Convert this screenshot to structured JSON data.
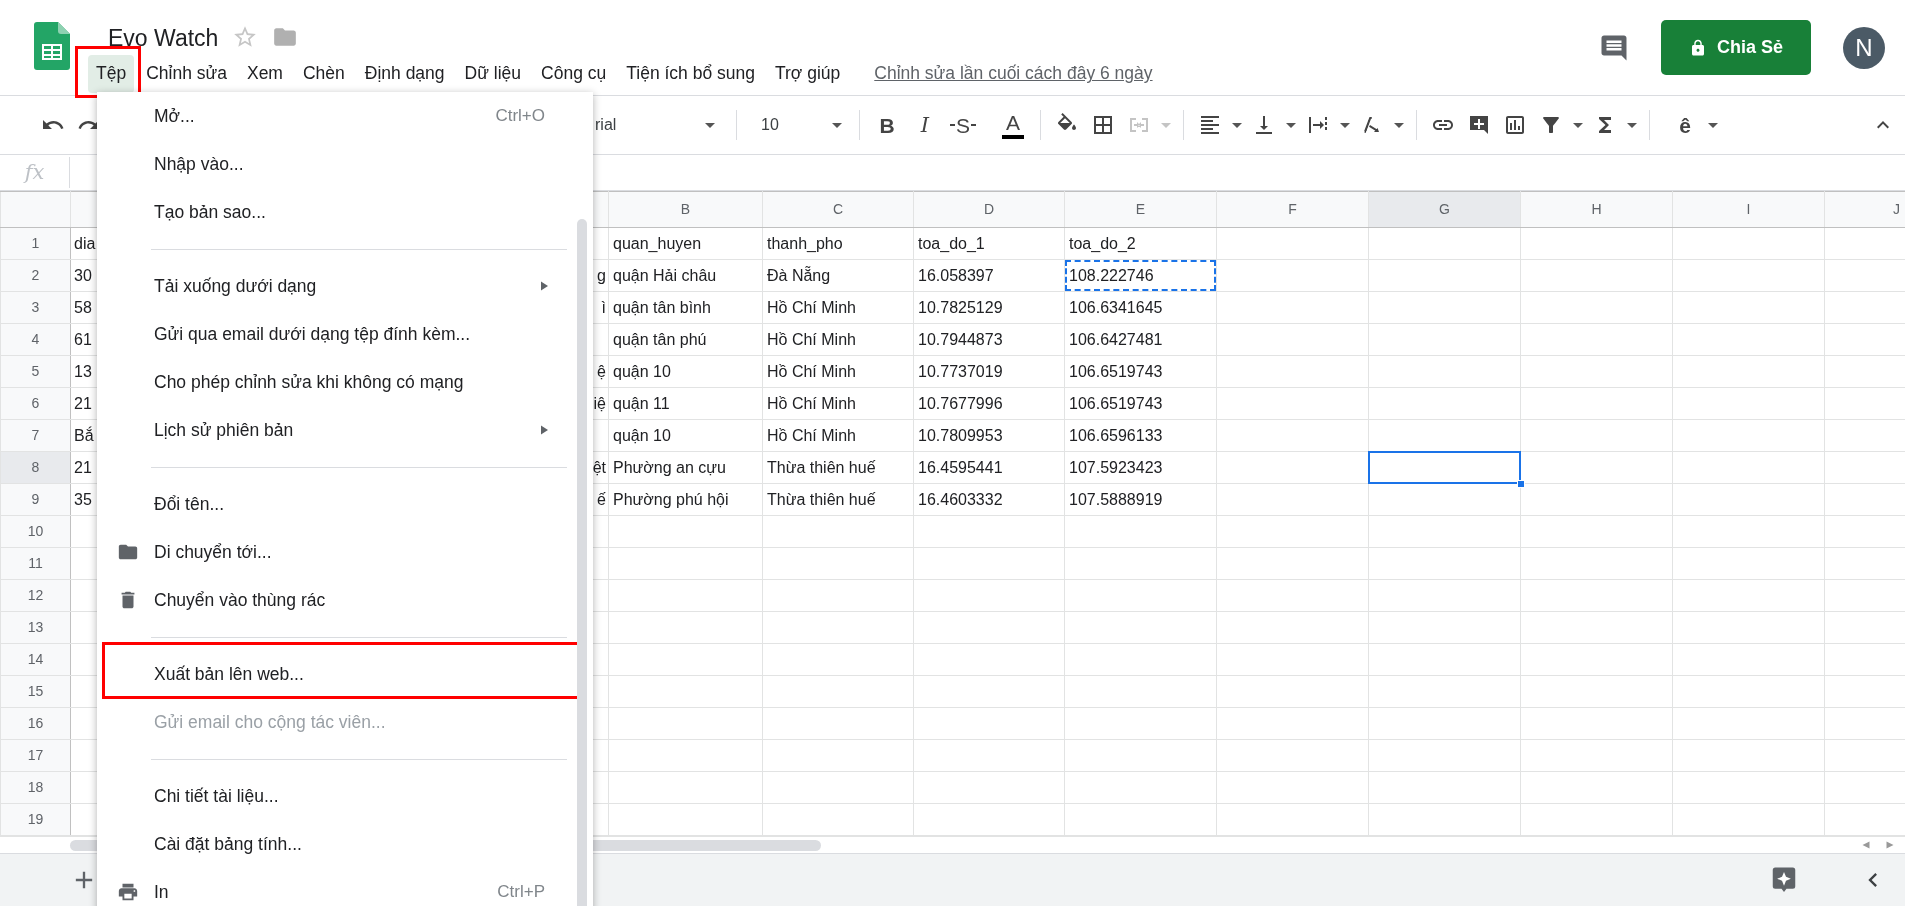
{
  "document": {
    "title": "Evo Watch",
    "starred": false,
    "last_edit": "Chỉnh sửa lần cuối cách đây 6 ngày"
  },
  "menubar": [
    {
      "label": "Tệp",
      "selected": true,
      "annotated": true
    },
    {
      "label": "Chỉnh sửa",
      "selected": false,
      "annotated": false
    },
    {
      "label": "Xem",
      "selected": false,
      "annotated": false
    },
    {
      "label": "Chèn",
      "selected": false,
      "annotated": false
    },
    {
      "label": "Định dạng",
      "selected": false,
      "annotated": false
    },
    {
      "label": "Dữ liệu",
      "selected": false,
      "annotated": false
    },
    {
      "label": "Công cụ",
      "selected": false,
      "annotated": false
    },
    {
      "label": "Tiện ích bổ sung",
      "selected": false,
      "annotated": false
    },
    {
      "label": "Trợ giúp",
      "selected": false,
      "annotated": false
    }
  ],
  "share_button": {
    "label": "Chia Sẻ"
  },
  "avatar": {
    "initial": "N"
  },
  "toolbar": {
    "font": "rial",
    "font_size": "10",
    "merge_disabled": true,
    "input_tool": "ê",
    "format_buttons": [
      {
        "kind": "bold",
        "glyph": "B"
      },
      {
        "kind": "italic",
        "glyph": "I"
      },
      {
        "kind": "strikethrough",
        "glyph": "S"
      },
      {
        "kind": "text_color",
        "glyph": "A"
      }
    ]
  },
  "formula_bar": {
    "label": "fx"
  },
  "columns": [
    {
      "label": "B",
      "selected": false
    },
    {
      "label": "C",
      "selected": false
    },
    {
      "label": "D",
      "selected": false
    },
    {
      "label": "E",
      "selected": false
    },
    {
      "label": "F",
      "selected": false
    },
    {
      "label": "G",
      "selected": true
    },
    {
      "label": "H",
      "selected": false
    },
    {
      "label": "I",
      "selected": false
    },
    {
      "label": "J",
      "selected": false
    }
  ],
  "rows": [
    {
      "number": "1",
      "selected": false,
      "column_a": {
        "start": "dia"
      },
      "cells": [
        {
          "text": "quan_huyen",
          "copied": false
        },
        {
          "text": "thanh_pho",
          "copied": false
        },
        {
          "text": "toa_do_1",
          "copied": false
        },
        {
          "text": "toa_do_2",
          "copied": false
        }
      ]
    },
    {
      "number": "2",
      "selected": false,
      "column_a": {
        "start": "30",
        "end": "g"
      },
      "cells": [
        {
          "text": "quận Hải châu",
          "copied": false
        },
        {
          "text": "Đà Nẵng",
          "copied": false
        },
        {
          "text": "16.058397",
          "copied": false
        },
        {
          "text": "108.222746",
          "copied": true
        }
      ]
    },
    {
      "number": "3",
      "selected": false,
      "column_a": {
        "start": "58",
        "end": "ì"
      },
      "cells": [
        {
          "text": "quận tân bình",
          "copied": false
        },
        {
          "text": "Hồ Chí Minh",
          "copied": false
        },
        {
          "text": "10.7825129",
          "copied": false
        },
        {
          "text": "106.6341645",
          "copied": false
        }
      ]
    },
    {
      "number": "4",
      "selected": false,
      "column_a": {
        "start": "61"
      },
      "cells": [
        {
          "text": "quận tân phú",
          "copied": false
        },
        {
          "text": "Hồ Chí Minh",
          "copied": false
        },
        {
          "text": "10.7944873",
          "copied": false
        },
        {
          "text": "106.6427481",
          "copied": false
        }
      ]
    },
    {
      "number": "5",
      "selected": false,
      "column_a": {
        "start": "13",
        "end": "ệ"
      },
      "cells": [
        {
          "text": "quận 10",
          "copied": false
        },
        {
          "text": "Hồ Chí Minh",
          "copied": false
        },
        {
          "text": "10.7737019",
          "copied": false
        },
        {
          "text": "106.6519743",
          "copied": false
        }
      ]
    },
    {
      "number": "6",
      "selected": false,
      "column_a": {
        "start": "21",
        "end": "iệ"
      },
      "cells": [
        {
          "text": "quận 11",
          "copied": false
        },
        {
          "text": "Hồ Chí Minh",
          "copied": false
        },
        {
          "text": "10.7677996",
          "copied": false
        },
        {
          "text": "106.6519743",
          "copied": false
        }
      ]
    },
    {
      "number": "7",
      "selected": false,
      "column_a": {
        "start": "Bắ"
      },
      "cells": [
        {
          "text": "quận 10",
          "copied": false
        },
        {
          "text": "Hồ Chí Minh",
          "copied": false
        },
        {
          "text": "10.7809953",
          "copied": false
        },
        {
          "text": "106.6596133",
          "copied": false
        }
      ]
    },
    {
      "number": "8",
      "selected": true,
      "column_a": {
        "start": "21",
        "end": "ệt"
      },
      "cells": [
        {
          "text": "Phường an cựu",
          "copied": false
        },
        {
          "text": "Thừa thiên huế",
          "copied": false
        },
        {
          "text": "16.4595441",
          "copied": false
        },
        {
          "text": "107.5923423",
          "copied": false
        }
      ]
    },
    {
      "number": "9",
      "selected": false,
      "column_a": {
        "start": "35",
        "end": "ế"
      },
      "cells": [
        {
          "text": "Phường phú hội",
          "copied": false
        },
        {
          "text": "Thừa thiên huế",
          "copied": false
        },
        {
          "text": "16.4603332",
          "copied": false
        },
        {
          "text": "107.5888919",
          "copied": false
        }
      ]
    },
    {
      "number": "10",
      "selected": false
    },
    {
      "number": "11",
      "selected": false
    },
    {
      "number": "12",
      "selected": false
    },
    {
      "number": "13",
      "selected": false
    },
    {
      "number": "14",
      "selected": false
    },
    {
      "number": "15",
      "selected": false
    },
    {
      "number": "16",
      "selected": false
    },
    {
      "number": "17",
      "selected": false
    },
    {
      "number": "18",
      "selected": false
    },
    {
      "number": "19",
      "selected": false
    }
  ],
  "file_menu": {
    "items": [
      {
        "kind": "item",
        "label": "Mở...",
        "shortcut": "Ctrl+O",
        "disabled": false,
        "submenu": false,
        "annotated": false
      },
      {
        "kind": "item",
        "label": "Nhập vào...",
        "disabled": false,
        "submenu": false,
        "annotated": false
      },
      {
        "kind": "item",
        "label": "Tạo bản sao...",
        "disabled": false,
        "submenu": false,
        "annotated": false
      },
      {
        "kind": "separator"
      },
      {
        "kind": "item",
        "label": "Tải xuống dưới dạng",
        "disabled": false,
        "submenu": true,
        "annotated": false
      },
      {
        "kind": "item",
        "label": "Gửi qua email dưới dạng tệp đính kèm...",
        "disabled": false,
        "submenu": false,
        "annotated": false
      },
      {
        "kind": "item",
        "label": "Cho phép chỉnh sửa khi không có mạng",
        "disabled": false,
        "submenu": false,
        "annotated": false
      },
      {
        "kind": "item",
        "label": "Lịch sử phiên bản",
        "disabled": false,
        "submenu": true,
        "annotated": false
      },
      {
        "kind": "separator"
      },
      {
        "kind": "item",
        "label": "Đổi tên...",
        "disabled": false,
        "submenu": false,
        "annotated": false
      },
      {
        "kind": "folder",
        "label": "Di chuyển tới...",
        "disabled": false,
        "submenu": false,
        "annotated": false
      },
      {
        "kind": "trash",
        "label": "Chuyển vào thùng rác",
        "disabled": false,
        "submenu": false,
        "annotated": false
      },
      {
        "kind": "separator"
      },
      {
        "kind": "item",
        "label": "Xuất bản lên web...",
        "disabled": false,
        "submenu": false,
        "annotated": true
      },
      {
        "kind": "item",
        "label": "Gửi email cho cộng tác viên...",
        "disabled": true,
        "submenu": false,
        "annotated": false
      },
      {
        "kind": "separator"
      },
      {
        "kind": "item",
        "label": "Chi tiết tài liệu...",
        "disabled": false,
        "submenu": false,
        "annotated": false
      },
      {
        "kind": "item",
        "label": "Cài đặt bảng tính...",
        "disabled": false,
        "submenu": false,
        "annotated": false
      },
      {
        "kind": "print",
        "label": "In",
        "shortcut": "Ctrl+P",
        "disabled": false,
        "submenu": false,
        "annotated": false
      }
    ]
  }
}
